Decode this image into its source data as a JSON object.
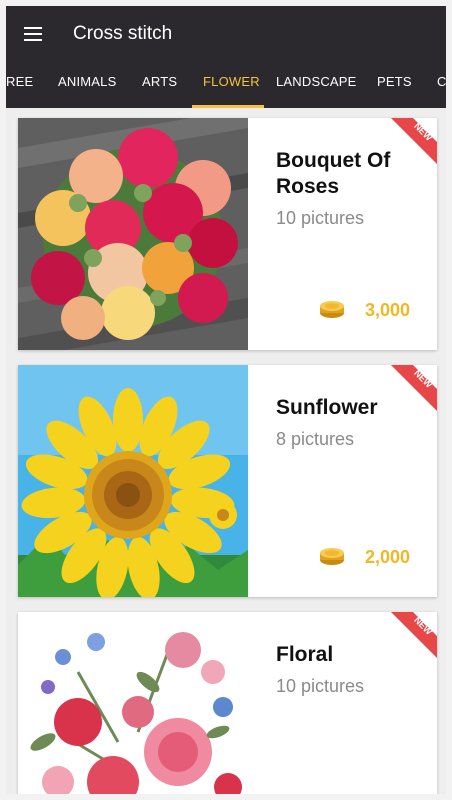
{
  "app": {
    "title": "Cross stitch"
  },
  "tabs": [
    "REE",
    "ANIMALS",
    "ARTS",
    "FLOWER",
    "LANDSCAPE",
    "PETS",
    "C"
  ],
  "active_tab": "FLOWER",
  "colors": {
    "appbar": "#2b292e",
    "accent": "#f5c242",
    "ribbon": "#e8474a",
    "price": "#f2b824"
  },
  "cards": [
    {
      "title": "Bouquet Of Roses",
      "count": "10 pictures",
      "price": "3,000",
      "badge": "NEW"
    },
    {
      "title": "Sunflower",
      "count": "8 pictures",
      "price": "2,000",
      "badge": "NEW"
    },
    {
      "title": "Floral",
      "count": "10 pictures",
      "price": "",
      "badge": "NEW"
    }
  ]
}
